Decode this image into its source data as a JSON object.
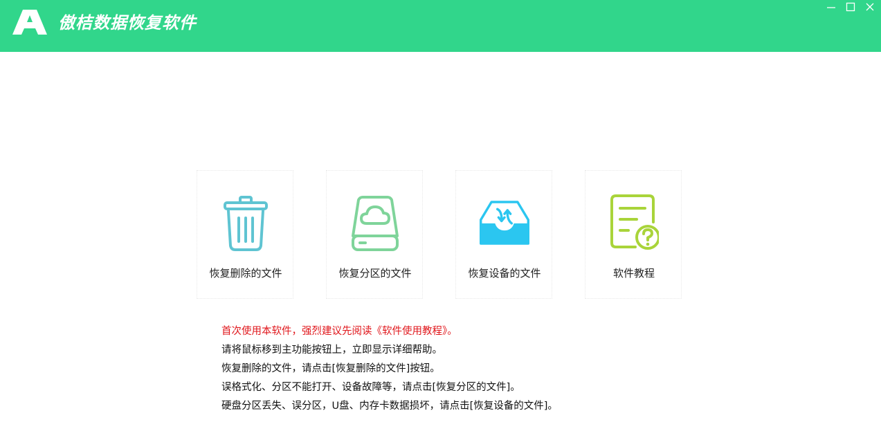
{
  "app": {
    "title": "傲桔数据恢复软件",
    "logo_letter": "A"
  },
  "colors": {
    "header_bg": "#31d68b",
    "trash_icon": "#5fc4d2",
    "drive_icon": "#7fd49a",
    "device_icon": "#2bc6f0",
    "tutorial_icon": "#a9d43a",
    "warning_text": "#e0161b"
  },
  "window_controls": [
    {
      "name": "minimize",
      "icon": "minimize-icon"
    },
    {
      "name": "maximize",
      "icon": "maximize-icon"
    },
    {
      "name": "close",
      "icon": "close-icon"
    }
  ],
  "functions": [
    {
      "label": "恢复删除的文件",
      "icon": "trash-icon"
    },
    {
      "label": "恢复分区的文件",
      "icon": "cloud-drive-icon"
    },
    {
      "label": "恢复设备的文件",
      "icon": "device-tray-icon"
    },
    {
      "label": "软件教程",
      "icon": "tutorial-document-icon"
    }
  ],
  "tips": [
    "首次使用本软件，强烈建议先阅读《软件使用教程》。",
    "请将鼠标移到主功能按钮上，立即显示详细帮助。",
    "恢复删除的文件，请点击[恢复删除的文件]按钮。",
    "误格式化、分区不能打开、设备故障等，请点击[恢复分区的文件]。",
    "硬盘分区丢失、误分区，U盘、内存卡数据损坏，请点击[恢复设备的文件]。"
  ]
}
